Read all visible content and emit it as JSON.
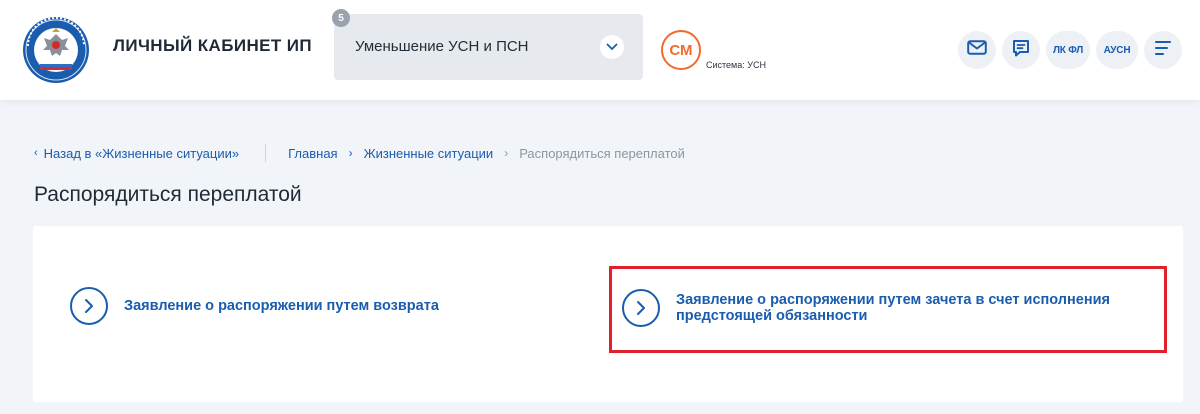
{
  "header": {
    "app_title": "ЛИЧНЫЙ КАБИНЕТ ИП",
    "logo_icon": "fns-emblem-icon",
    "selector": {
      "value": "Уменьшение УСН и ПСН",
      "badge_count": "5",
      "chevron_icon": "chevron-down-icon"
    },
    "user": {
      "initials": "СМ",
      "system_label": "Система: УСН"
    },
    "actions": {
      "mail_icon": "mail-icon",
      "chat_icon": "chat-icon",
      "lk_fl_label": "ЛК ФЛ",
      "ausn_label": "АУСН",
      "menu_icon": "menu-icon"
    }
  },
  "breadcrumbs": {
    "back_label": "Назад в «Жизненные ситуации»",
    "items": [
      "Главная",
      "Жизненные ситуации"
    ],
    "current": "Распорядиться переплатой"
  },
  "page": {
    "title": "Распорядиться переплатой"
  },
  "options": [
    {
      "label": "Заявление о распоряжении путем возврата",
      "icon": "chevron-right-circle-icon"
    },
    {
      "label": "Заявление о распоряжении путем зачета в счет исполнения предстоящей обязанности",
      "icon": "chevron-right-circle-icon",
      "highlighted": true
    }
  ],
  "colors": {
    "accent": "#1a5cae",
    "avatar": "#f26b2d",
    "highlight": "#e0202a",
    "background": "#f1f4f8"
  }
}
